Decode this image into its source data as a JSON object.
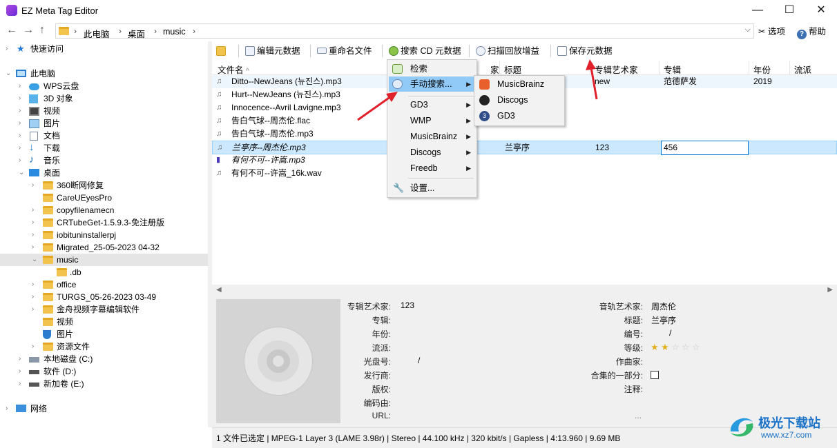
{
  "window": {
    "title": "EZ Meta Tag Editor",
    "min": "—",
    "max": "☐",
    "close": "✕"
  },
  "address": {
    "crumbs": [
      "此电脑",
      "桌面",
      "music"
    ],
    "sep": "›",
    "options": "选项",
    "help": "帮助"
  },
  "tree": [
    {
      "label": "快速访问",
      "icon": "star-icon"
    },
    {
      "label": "此电脑",
      "icon": "computer-icon"
    },
    {
      "label": "WPS云盘",
      "icon": "cloud-icon"
    },
    {
      "label": "3D 对象",
      "icon": "cube-icon"
    },
    {
      "label": "视频",
      "icon": "video-icon"
    },
    {
      "label": "图片",
      "icon": "picture-icon"
    },
    {
      "label": "文档",
      "icon": "document-icon"
    },
    {
      "label": "下载",
      "icon": "download-icon"
    },
    {
      "label": "音乐",
      "icon": "music-icon"
    },
    {
      "label": "桌面",
      "icon": "desktop-icon"
    },
    {
      "label": "360断网修复",
      "icon": "folder-icon"
    },
    {
      "label": "CareUEyesPro",
      "icon": "folder-icon"
    },
    {
      "label": "copyfilenamecn",
      "icon": "folder-icon"
    },
    {
      "label": "CRTubeGet-1.5.9.3-免注册版",
      "icon": "folder-icon"
    },
    {
      "label": "iobituninstallerpj",
      "icon": "folder-icon"
    },
    {
      "label": "Migrated_25-05-2023 04-32",
      "icon": "folder-icon"
    },
    {
      "label": "music",
      "icon": "folder-icon"
    },
    {
      "label": ".db",
      "icon": "folder-icon"
    },
    {
      "label": "office",
      "icon": "folder-icon"
    },
    {
      "label": "TURGS_05-26-2023 03-49",
      "icon": "folder-icon"
    },
    {
      "label": "金舟视频字幕编辑软件",
      "icon": "folder-icon"
    },
    {
      "label": "视频",
      "icon": "folder-icon"
    },
    {
      "label": "图片",
      "icon": "shield-folder-icon"
    },
    {
      "label": "资源文件",
      "icon": "folder-icon"
    },
    {
      "label": "本地磁盘 (C:)",
      "icon": "drive-icon"
    },
    {
      "label": "软件 (D:)",
      "icon": "drive-icon"
    },
    {
      "label": "新加卷 (E:)",
      "icon": "drive-icon"
    },
    {
      "label": "网络",
      "icon": "network-icon"
    }
  ],
  "toolbar": {
    "edit": "编辑元数据",
    "rename": "重命名文件",
    "search_cd": "搜索 CD 元数据",
    "scan": "扫描回放增益",
    "save": "保存元数据"
  },
  "columns": {
    "filename": "文件名",
    "title": "标题",
    "album_artist": "专辑艺术家",
    "album": "专辑",
    "year": "年份",
    "genre": "流派",
    "sort_arrow": "^",
    "partial": "家"
  },
  "files": [
    {
      "name": "Ditto--NewJeans (뉴진스).mp3",
      "title": "",
      "album_artist": "new",
      "album": "范德萨发",
      "year": "2019"
    },
    {
      "name": "Hurt--NewJeans (뉴진스).mp3",
      "title": "",
      "album_artist": "",
      "album": "",
      "year": ""
    },
    {
      "name": "Innocence--Avril Lavigne.mp3",
      "title": "",
      "album_artist": "",
      "album": "",
      "year": ""
    },
    {
      "name": "告白气球--周杰伦.flac",
      "title": "",
      "album_artist": "",
      "album": "",
      "year": ""
    },
    {
      "name": "告白气球--周杰伦.mp3",
      "title": "",
      "album_artist": "",
      "album": "",
      "year": ""
    },
    {
      "name": "兰亭序--周杰伦.mp3",
      "title": "兰亭序",
      "album_artist": "123",
      "album": "456",
      "year": ""
    },
    {
      "name": "有何不可--许嵩.mp3",
      "title": "",
      "album_artist": "",
      "album": "",
      "year": ""
    },
    {
      "name": "有何不可--许嵩_16k.wav",
      "title": "",
      "album_artist": "",
      "album": "",
      "year": ""
    }
  ],
  "menu": {
    "items": [
      "检索",
      "手动搜索...",
      "GD3",
      "WMP",
      "MusicBrainz",
      "Discogs",
      "Freedb",
      "设置..."
    ],
    "submenu": [
      "MusicBrainz",
      "Discogs",
      "GD3"
    ]
  },
  "details": {
    "left": [
      {
        "label": "专辑艺术家:",
        "value": "123"
      },
      {
        "label": "专辑:",
        "value": ""
      },
      {
        "label": "年份:",
        "value": ""
      },
      {
        "label": "流派:",
        "value": ""
      },
      {
        "label": "光盘号:",
        "value": "/"
      },
      {
        "label": "发行商:",
        "value": ""
      },
      {
        "label": "版权:",
        "value": ""
      },
      {
        "label": "编码由:",
        "value": ""
      },
      {
        "label": "URL:",
        "value": ""
      }
    ],
    "right": [
      {
        "label": "音轨艺术家:",
        "value": "周杰伦"
      },
      {
        "label": "标题:",
        "value": "兰亭序"
      },
      {
        "label": "编号:",
        "value": "/"
      },
      {
        "label": "等级:",
        "value": ""
      },
      {
        "label": "作曲家:",
        "value": ""
      },
      {
        "label": "合集的一部分:",
        "value": ""
      },
      {
        "label": "注释:",
        "value": ""
      }
    ],
    "rating": 2,
    "rating_max": 5,
    "ellipsis": "..."
  },
  "status": "1 文件已选定 | MPEG-1 Layer 3 (LAME 3.98r) | Stereo | 44.100 kHz | 320 kbit/s | Gapless | 4:13.960 | 9.69 MB",
  "watermark": {
    "brand": "极光下载站",
    "url": "www.xz7.com"
  },
  "colors": {
    "selection": "#cce8ff",
    "menu_highlight": "#91c9f7",
    "arrow": "#e0202a"
  }
}
